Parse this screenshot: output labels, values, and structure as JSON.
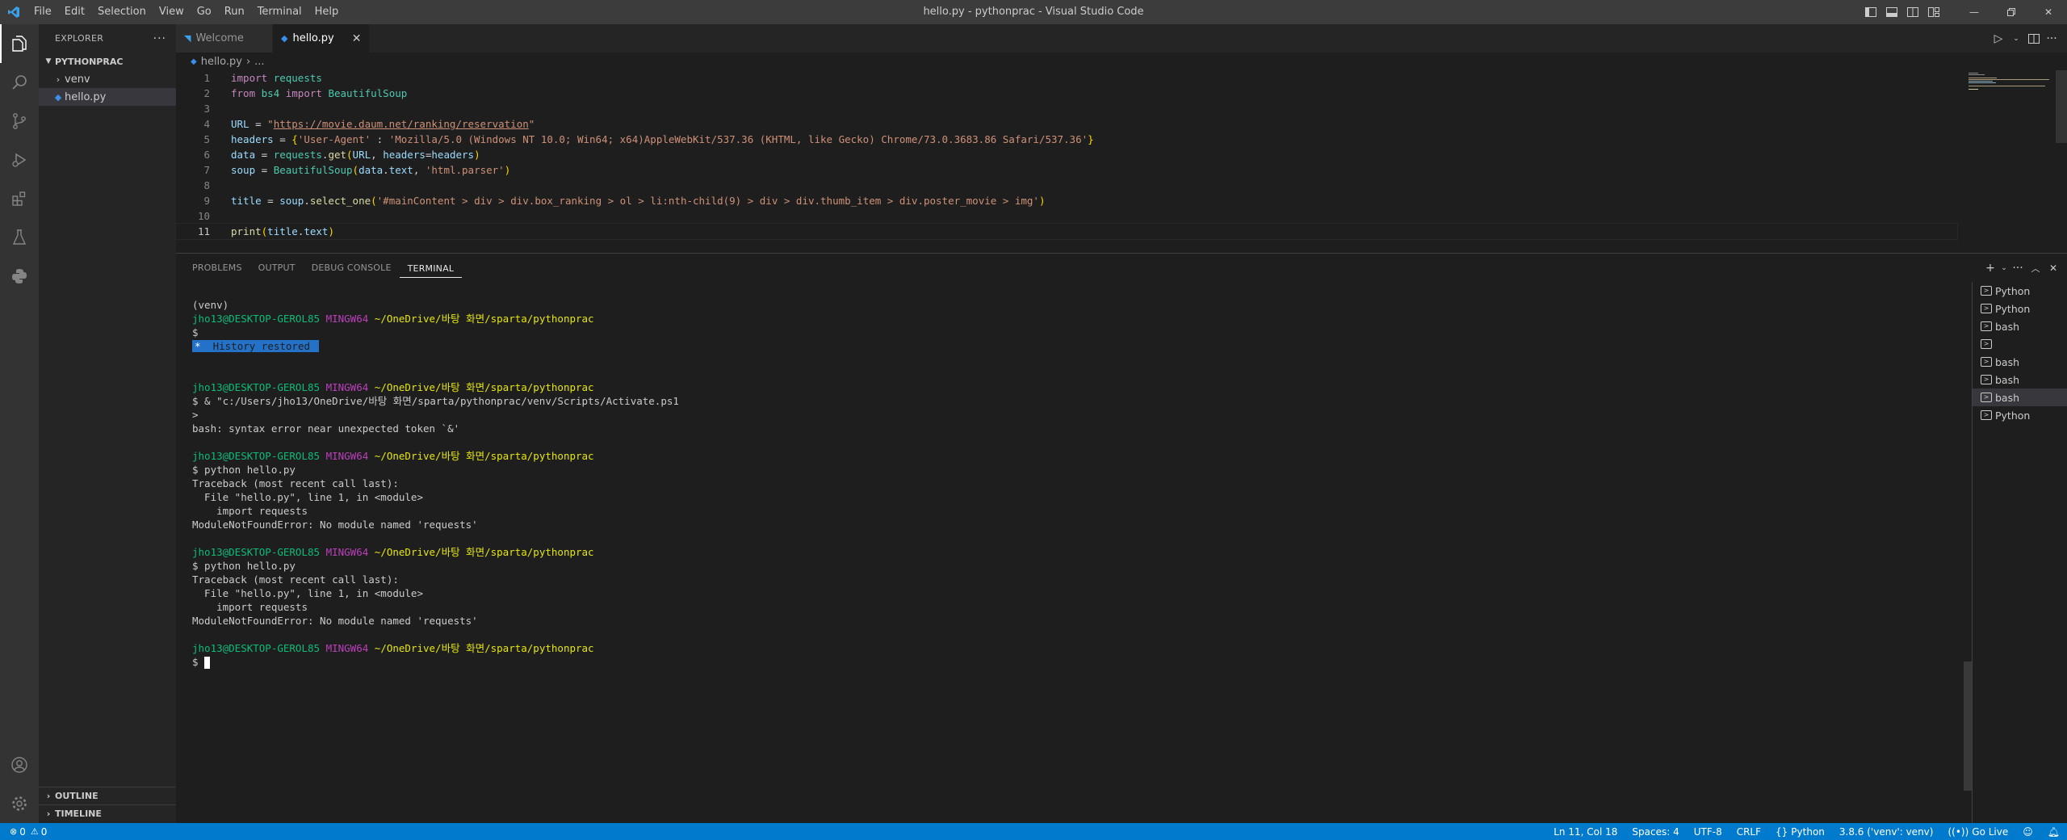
{
  "window": {
    "title": "hello.py - pythonprac - Visual Studio Code",
    "menu": [
      "File",
      "Edit",
      "Selection",
      "View",
      "Go",
      "Run",
      "Terminal",
      "Help"
    ]
  },
  "sidebar": {
    "header": "EXPLORER",
    "folder": "PYTHONPRAC",
    "items": [
      {
        "label": "venv",
        "type": "folder"
      },
      {
        "label": "hello.py",
        "type": "file"
      }
    ],
    "outline": "OUTLINE",
    "timeline": "TIMELINE"
  },
  "tabs": [
    {
      "label": "Welcome",
      "active": false
    },
    {
      "label": "hello.py",
      "active": true
    }
  ],
  "breadcrumb": {
    "file": "hello.py",
    "rest": "..."
  },
  "editor": {
    "current_line": 11,
    "lines": [
      {
        "n": "1",
        "text": "import requests"
      },
      {
        "n": "2",
        "text": "from bs4 import BeautifulSoup"
      },
      {
        "n": "3",
        "text": ""
      },
      {
        "n": "4",
        "text": "URL = \"https://movie.daum.net/ranking/reservation\""
      },
      {
        "n": "5",
        "text": "headers = {'User-Agent' : 'Mozilla/5.0 (Windows NT 10.0; Win64; x64)AppleWebKit/537.36 (KHTML, like Gecko) Chrome/73.0.3683.86 Safari/537.36'}"
      },
      {
        "n": "6",
        "text": "data = requests.get(URL, headers=headers)"
      },
      {
        "n": "7",
        "text": "soup = BeautifulSoup(data.text, 'html.parser')"
      },
      {
        "n": "8",
        "text": ""
      },
      {
        "n": "9",
        "text": "title = soup.select_one('#mainContent > div > div.box_ranking > ol > li:nth-child(9) > div > div.thumb_item > div.poster_movie > img')"
      },
      {
        "n": "10",
        "text": ""
      },
      {
        "n": "11",
        "text": "print(title.text)"
      }
    ]
  },
  "panel": {
    "tabs": [
      "PROBLEMS",
      "OUTPUT",
      "DEBUG CONSOLE",
      "TERMINAL"
    ],
    "active_tab": "TERMINAL",
    "prompt_user": "jho13@DESKTOP-GEROL85",
    "prompt_env": "MINGW64",
    "prompt_path": "~/OneDrive/바탕 화면/sparta/pythonprac",
    "terminal": {
      "venv": "(venv)",
      "dollar": "$",
      "history": "History restored",
      "cmd_activate": "$ & \"c:/Users/jho13/OneDrive/바탕 화면/sparta/pythonprac/venv/Scripts/Activate.ps1",
      "gt": ">",
      "syntax_error": "bash: syntax error near unexpected token `&'",
      "cmd_run": "$ python hello.py",
      "tb1": "Traceback (most recent call last):",
      "tb2": "  File \"hello.py\", line 1, in <module>",
      "tb3": "    import requests",
      "tb4": "ModuleNotFoundError: No module named 'requests'"
    },
    "terminal_list": [
      {
        "label": "Python",
        "selected": false
      },
      {
        "label": "Python",
        "selected": false
      },
      {
        "label": "bash",
        "selected": false
      },
      {
        "label": "",
        "selected": false
      },
      {
        "label": "bash",
        "selected": false
      },
      {
        "label": "bash",
        "selected": false
      },
      {
        "label": "bash",
        "selected": true
      },
      {
        "label": "Python",
        "selected": false
      }
    ]
  },
  "statusbar": {
    "errors": "0",
    "warnings": "0",
    "position": "Ln 11, Col 18",
    "spaces": "Spaces: 4",
    "encoding": "UTF-8",
    "eol": "CRLF",
    "language": "Python",
    "interpreter": "3.8.6 ('venv': venv)",
    "golive": "Go Live"
  },
  "colors": {
    "accent": "#007acc",
    "titlebar": "#3c3c3c",
    "editor_bg": "#1e1e1e"
  }
}
